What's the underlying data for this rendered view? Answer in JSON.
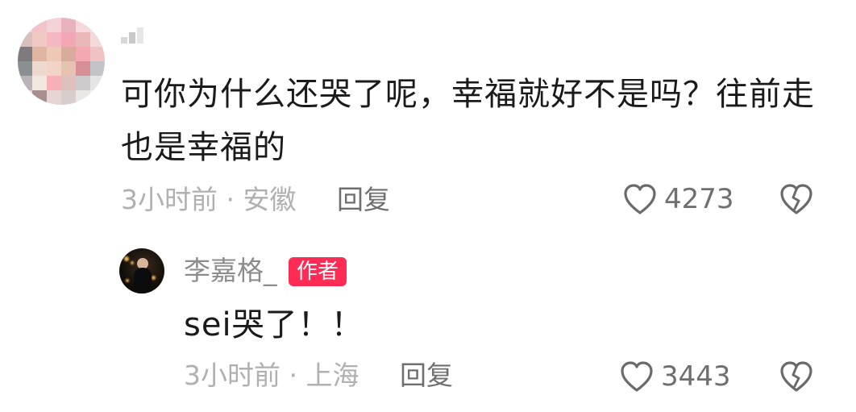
{
  "main_comment": {
    "text": "可你为什么还哭了呢，幸福就好不是吗？往前走也是幸福的",
    "time": "3小时前",
    "separator": "·",
    "location": "安徽",
    "reply_label": "回复",
    "like_count": "4273"
  },
  "reply_comment": {
    "username": "李嘉格_",
    "badge": "作者",
    "text": "sei哭了！！",
    "time": "3小时前",
    "separator": "·",
    "location": "上海",
    "reply_label": "回复",
    "like_count": "3443"
  },
  "icons": {
    "like": "heart-outline-icon",
    "dislike": "broken-heart-icon"
  },
  "colors": {
    "author_badge": "#fe2c55",
    "text": "#1a1a1a",
    "meta": "#a3a3a3"
  }
}
